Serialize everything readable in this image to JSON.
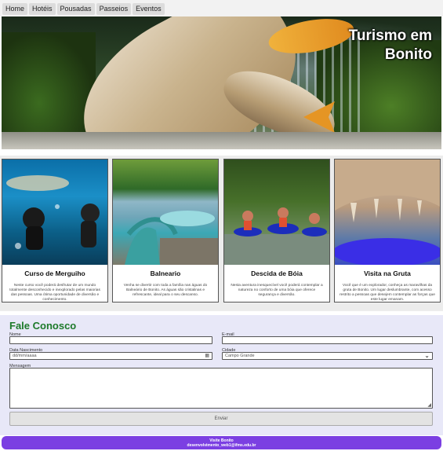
{
  "nav": {
    "items": [
      "Home",
      "Hotéis",
      "Pousadas",
      "Passeios",
      "Eventos"
    ]
  },
  "hero": {
    "title_line1": "Turismo em",
    "title_line2": "Bonito"
  },
  "cards": [
    {
      "title": "Curso de Merguiho",
      "description": "Neste curso você poderá desfrutar de um mundo totalmente desconhecido e inexplorado pelas maiorias das pessoas. Uma ótima oportunidade de diversão e conhecimento."
    },
    {
      "title": "Balneario",
      "description": "Venha se divertir com toda a família nas águas do Balneário de Bonito. As águas são cristalinas e refrescante, ideal para o seu descanso."
    },
    {
      "title": "Descida de Bóia",
      "description": "Nesta aventura inesquecível você poderá contemplar a natureza no conforto de uma bóia que oferece segurança e diversão."
    },
    {
      "title": "Visita na Gruta",
      "description": "Você que é um explorador, conheça as maravilhas da gruta de Bonito. Um lugar deslumbrante, com acesso restrito a pessoas que desejem contemplar as forças que este lugar emanam."
    }
  ],
  "contact": {
    "heading": "Fale Conosco",
    "name_label": "Nome",
    "email_label": "E-mail",
    "birth_label": "Data Nascimento",
    "birth_placeholder": "dd/mm/aaaa",
    "city_label": "Cidade",
    "city_value": "Campo Grande",
    "message_label": "Mensagem",
    "submit_label": "Enviar"
  },
  "footer": {
    "line1": "Visite Bonito",
    "line2": "desenvolvimento_web1@ifms.edu.br"
  },
  "colors": {
    "heading_green": "#1d7a2a",
    "footer_purple": "#7b3fe2",
    "contact_bg": "#e8e8f8"
  }
}
